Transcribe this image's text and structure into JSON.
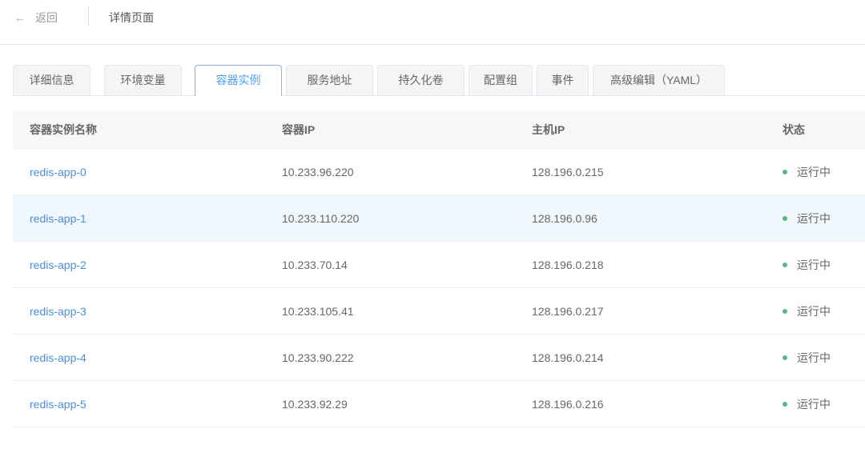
{
  "header": {
    "back_label": "返回",
    "title": "详情页面"
  },
  "tabs": [
    {
      "label": "详细信息",
      "active": false
    },
    {
      "label": "环境变量",
      "active": false
    },
    {
      "label": "容器实例",
      "active": true
    },
    {
      "label": "服务地址",
      "active": false
    },
    {
      "label": "持久化卷",
      "active": false
    },
    {
      "label": "配置组",
      "active": false
    },
    {
      "label": "事件",
      "active": false
    },
    {
      "label": "高级编辑（YAML）",
      "active": false
    }
  ],
  "table": {
    "columns": [
      "容器实例名称",
      "容器IP",
      "主机IP",
      "状态"
    ],
    "rows": [
      {
        "name": "redis-app-0",
        "container_ip": "10.233.96.220",
        "host_ip": "128.196.0.215",
        "status": "运行中"
      },
      {
        "name": "redis-app-1",
        "container_ip": "10.233.110.220",
        "host_ip": "128.196.0.96",
        "status": "运行中"
      },
      {
        "name": "redis-app-2",
        "container_ip": "10.233.70.14",
        "host_ip": "128.196.0.218",
        "status": "运行中"
      },
      {
        "name": "redis-app-3",
        "container_ip": "10.233.105.41",
        "host_ip": "128.196.0.217",
        "status": "运行中"
      },
      {
        "name": "redis-app-4",
        "container_ip": "10.233.90.222",
        "host_ip": "128.196.0.214",
        "status": "运行中"
      },
      {
        "name": "redis-app-5",
        "container_ip": "10.233.92.29",
        "host_ip": "128.196.0.216",
        "status": "运行中"
      }
    ]
  },
  "colors": {
    "accent": "#409eff",
    "link": "#4a90d9",
    "status_running": "#5cb87a",
    "row_hover": "#f0f7fd"
  }
}
